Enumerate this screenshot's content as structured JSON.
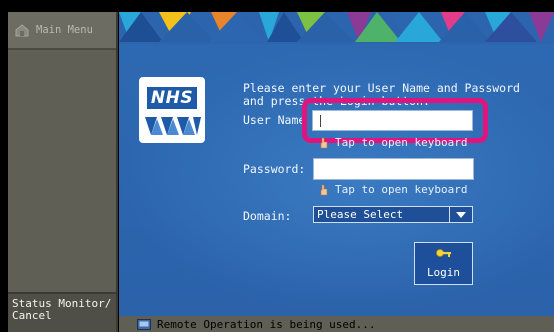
{
  "sidebar": {
    "main_menu_label": "Main Menu",
    "status_monitor_label": "Status Monitor/\nCancel"
  },
  "logo": {
    "text": "NHS"
  },
  "login_form": {
    "instructions_line1": "Please enter your User Name and Password",
    "instructions_line2": "and press the Login button.",
    "username_label": "User Name",
    "username_value": "",
    "username_keyboard_hint": "Tap to open keyboard",
    "password_label": "Password:",
    "password_value": "",
    "password_keyboard_hint": "Tap to open keyboard",
    "domain_label": "Domain:",
    "domain_selected": "Please Select",
    "login_button_label": "Login"
  },
  "status_bar": {
    "message": "Remote Operation is being used..."
  },
  "colors": {
    "highlight": "#e0147c",
    "panel_blue": "#2b62aa",
    "banner_triangles": [
      "#29a7d8",
      "#f2c21b",
      "#e8842a",
      "#7cc142",
      "#8b3a96",
      "#e23c8b",
      "#2d4f9d"
    ]
  },
  "icons": {
    "main_menu": "house-icon",
    "hint": "hand-pointer-icon",
    "domain_dropdown": "chevron-down-icon",
    "login": "key-icon",
    "status": "remote-monitor-icon"
  }
}
